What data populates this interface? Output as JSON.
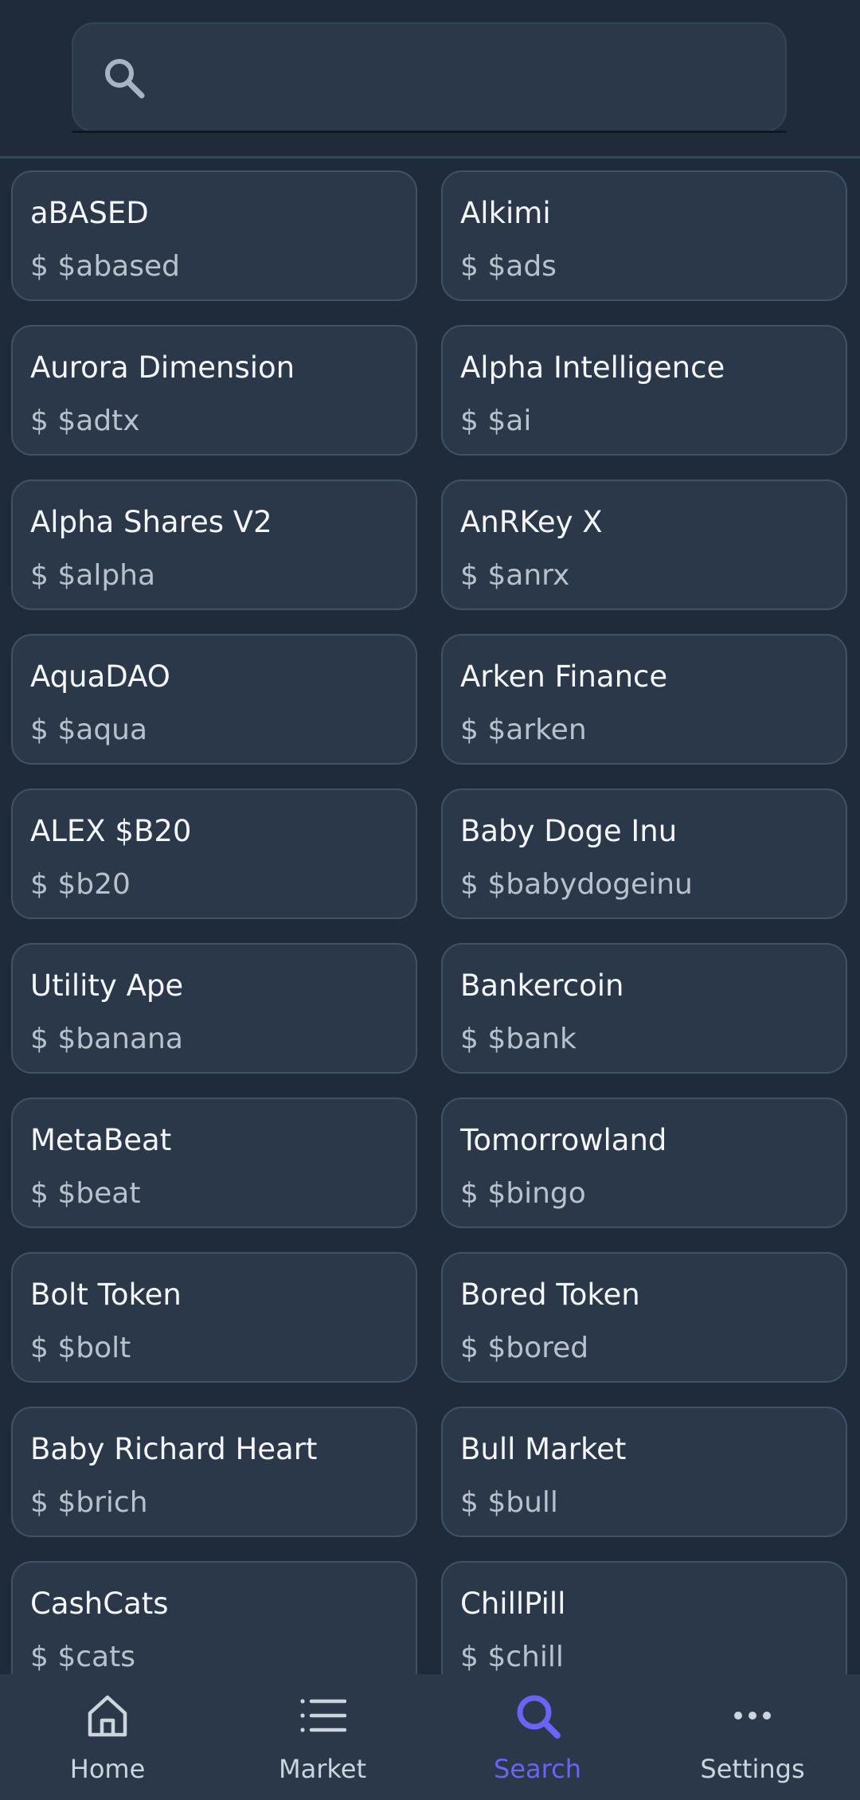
{
  "search": {
    "placeholder": "",
    "value": ""
  },
  "tokens": [
    {
      "name": "aBASED",
      "symbol": "$ $abased"
    },
    {
      "name": "Alkimi",
      "symbol": "$ $ads"
    },
    {
      "name": "Aurora Dimension",
      "symbol": "$ $adtx"
    },
    {
      "name": "Alpha Intelligence",
      "symbol": "$ $ai"
    },
    {
      "name": "Alpha Shares V2",
      "symbol": "$ $alpha"
    },
    {
      "name": "AnRKey X",
      "symbol": "$ $anrx"
    },
    {
      "name": "AquaDAO",
      "symbol": "$ $aqua"
    },
    {
      "name": "Arken Finance",
      "symbol": "$ $arken"
    },
    {
      "name": "ALEX $B20",
      "symbol": "$ $b20"
    },
    {
      "name": "Baby Doge Inu",
      "symbol": "$ $babydogeinu"
    },
    {
      "name": "Utility Ape",
      "symbol": "$ $banana"
    },
    {
      "name": "Bankercoin",
      "symbol": "$ $bank"
    },
    {
      "name": "MetaBeat",
      "symbol": "$ $beat"
    },
    {
      "name": "Tomorrowland",
      "symbol": "$ $bingo"
    },
    {
      "name": "Bolt Token",
      "symbol": "$ $bolt"
    },
    {
      "name": "Bored Token",
      "symbol": "$ $bored"
    },
    {
      "name": "Baby Richard Heart",
      "symbol": "$ $brich"
    },
    {
      "name": "Bull Market",
      "symbol": "$ $bull"
    },
    {
      "name": "CashCats",
      "symbol": "$ $cats"
    },
    {
      "name": "ChillPill",
      "symbol": "$ $chill"
    }
  ],
  "nav": {
    "items": [
      {
        "label": "Home",
        "icon": "home-icon",
        "active": false
      },
      {
        "label": "Market",
        "icon": "list-icon",
        "active": false
      },
      {
        "label": "Search",
        "icon": "search-icon",
        "active": true
      },
      {
        "label": "Settings",
        "icon": "more-horizontal-icon",
        "active": false
      }
    ]
  },
  "colors": {
    "background": "#1f2b3a",
    "card": "#2a3849",
    "card_border": "#415166",
    "accent": "#6a63f6",
    "text_primary": "#f4f6f9",
    "text_secondary": "#b9c1cc"
  }
}
